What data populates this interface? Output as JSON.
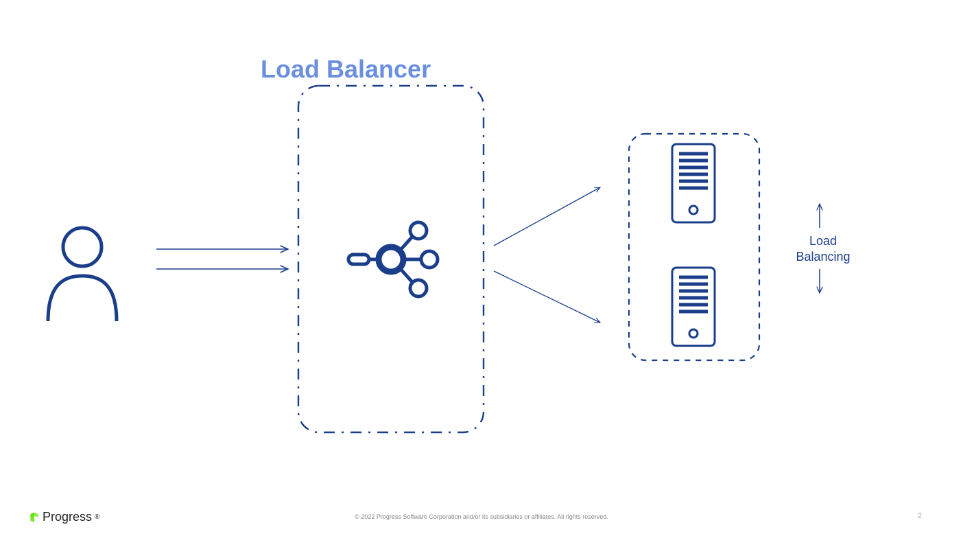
{
  "title": "Load Balancer",
  "label": {
    "line1": "Load",
    "line2": "Balancing"
  },
  "footer": {
    "copyright": "© 2022 Progress Software Corporation and/or its subsidiaries or affiliates. All rights reserved.",
    "page": "2",
    "brand": "Progress"
  },
  "colors": {
    "title": "#6b8fe0",
    "line": "#1a3e8a",
    "dark": "#1a3e8a",
    "brandGreen": "#5ce500"
  },
  "diagram": {
    "nodes": [
      {
        "id": "user",
        "type": "user-icon"
      },
      {
        "id": "lb",
        "type": "load-balancer-icon",
        "container": "dash-dot-box"
      },
      {
        "id": "server1",
        "type": "server-icon"
      },
      {
        "id": "server2",
        "type": "server-icon"
      },
      {
        "id": "server-group",
        "type": "dashed-box",
        "contains": [
          "server1",
          "server2"
        ]
      }
    ],
    "arrows": [
      {
        "from": "user",
        "to": "lb",
        "count": 2,
        "style": "straight"
      },
      {
        "from": "lb",
        "to": "server1",
        "style": "diagonal"
      },
      {
        "from": "lb",
        "to": "server2",
        "style": "diagonal"
      },
      {
        "id": "lb-indicator",
        "style": "double-headed-vertical",
        "label_ref": "Load Balancing"
      }
    ]
  }
}
